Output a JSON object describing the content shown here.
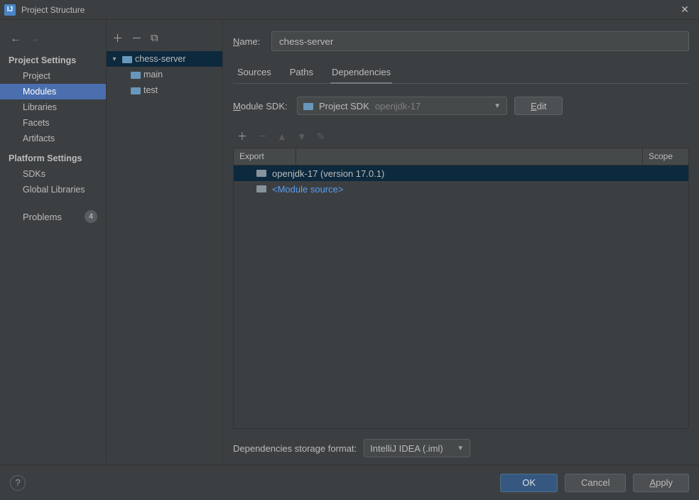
{
  "window": {
    "title": "Project Structure",
    "icon_label": "IJ"
  },
  "nav": {
    "back_enabled": true,
    "forward_enabled": false
  },
  "sidebar": {
    "section1": "Project Settings",
    "items1": [
      "Project",
      "Modules",
      "Libraries",
      "Facets",
      "Artifacts"
    ],
    "selected1_index": 1,
    "section2": "Platform Settings",
    "items2": [
      "SDKs",
      "Global Libraries"
    ],
    "problems_label": "Problems",
    "problems_count": "4"
  },
  "tree": {
    "root": "chess-server",
    "children": [
      "main",
      "test"
    ]
  },
  "details": {
    "name_label": "Name:",
    "name_value": "chess-server",
    "tabs": [
      "Sources",
      "Paths",
      "Dependencies"
    ],
    "active_tab_index": 2,
    "module_sdk_label": "Module SDK:",
    "module_sdk_prefix": "Project SDK",
    "module_sdk_value": "openjdk-17",
    "edit_label": "Edit",
    "table": {
      "col_export": "Export",
      "col_scope": "Scope",
      "rows": [
        {
          "text": "openjdk-17 (version 17.0.1)",
          "link": false,
          "selected": true
        },
        {
          "text": "<Module source>",
          "link": true,
          "selected": false
        }
      ]
    },
    "storage_label": "Dependencies storage format:",
    "storage_value": "IntelliJ IDEA (.iml)"
  },
  "footer": {
    "ok": "OK",
    "cancel": "Cancel",
    "apply": "Apply"
  }
}
